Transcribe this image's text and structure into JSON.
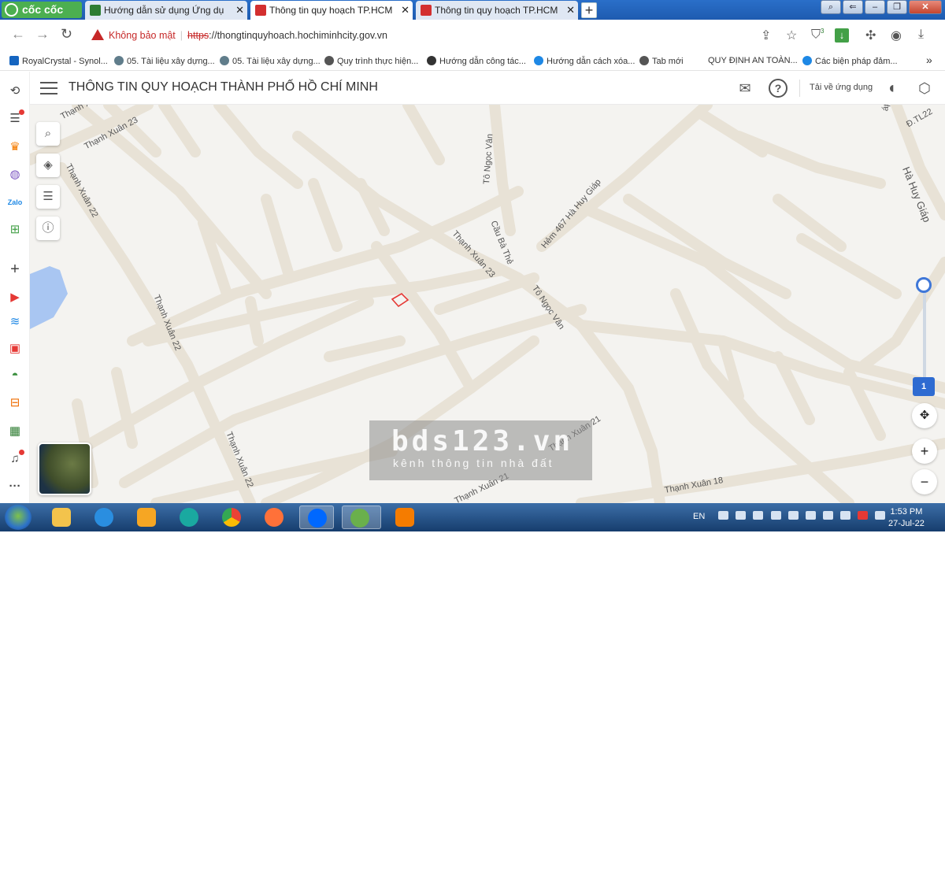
{
  "browser": {
    "brand": "cốc cốc",
    "tabs": [
      {
        "title": "Hướng dẫn sử dụng Ứng dụ",
        "favicon_color": "#2e7d32",
        "active": false
      },
      {
        "title": "Thông tin quy hoạch TP.HCM",
        "favicon_color": "#d32f2f",
        "active": true
      },
      {
        "title": "Thông tin quy hoạch TP.HCM",
        "favicon_color": "#d32f2f",
        "active": false
      }
    ],
    "new_tab_label": "+",
    "security_label": "Không bảo mật",
    "url_scheme": "https",
    "url_rest": "://thongtinquyhoach.hochiminhcity.gov.vn",
    "bookmarks": [
      "RoyalCrystal - Synol...",
      "05. Tài liệu xây dựng...",
      "05. Tài liệu xây dựng...",
      "Quy trình thực hiện...",
      "Hướng dẫn công tác...",
      "Hướng dẫn cách xóa...",
      "Tab mới",
      "QUY ĐỊNH AN TOÀN...",
      "Các biện pháp đảm..."
    ],
    "bookmarks_more": "»",
    "extension_badge": "3"
  },
  "app": {
    "title": "THÔNG TIN QUY HOẠCH THÀNH PHỐ HỒ CHÍ MINH",
    "download_label": "Tải về ứng dụng"
  },
  "map": {
    "road_labels": [
      "Thạnh Xuân",
      "Thạnh Xuân 23",
      "Thạnh Xuân 22",
      "Tô Ngọc Vân",
      "Cầu Bà Thẻ",
      "Thạnh Xuân 23",
      "Hẻm 467 Hà Huy Giáp",
      "Hà Huy Giáp",
      "Tô Ngọc Vân",
      "Thạnh Xuân 22",
      "Thạnh Xuân 22",
      "Thạnh Xuân 21",
      "Thạnh Xuân 21",
      "Thạnh Xuân 18",
      "áp",
      "Đ.TL22"
    ],
    "zoom_level": "1",
    "zoom_in": "+",
    "zoom_out": "−",
    "accent_color": "#2e6bd1",
    "parcel_color": "#e53935"
  },
  "watermark": {
    "main": "bds123.vn",
    "sub": "kênh thông tin nhà đất"
  },
  "taskbar": {
    "language": "EN",
    "time": "1:53 PM",
    "date": "27-Jul-22"
  }
}
